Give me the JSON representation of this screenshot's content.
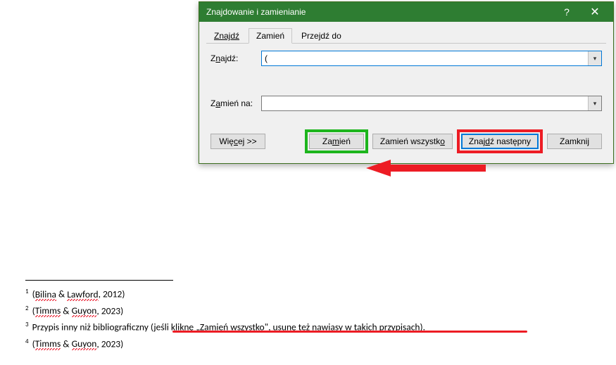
{
  "dialog": {
    "title": "Znajdowanie i zamienianie",
    "help_symbol": "?",
    "close_symbol": "✕",
    "tabs": {
      "find": "Znajdź",
      "replace": "Zamień",
      "goto": "Przejdź do"
    },
    "find_label_pre": "Z",
    "find_label_ul": "n",
    "find_label_post": "ajdź:",
    "find_value": "(",
    "replace_label_pre": "Z",
    "replace_label_ul": "a",
    "replace_label_post": "mień na:",
    "replace_value": "",
    "buttons": {
      "more_pre": "Wię",
      "more_ul": "c",
      "more_post": "ej >>",
      "replace_pre": "Za",
      "replace_ul": "m",
      "replace_post": "ień",
      "replace_all_pre": "Zamień wszystk",
      "replace_all_ul": "o",
      "replace_all_post": "",
      "find_next_pre": "Znaj",
      "find_next_ul": "d",
      "find_next_post": "ź następny",
      "close": "Zamknij"
    }
  },
  "footnotes": {
    "fn1": {
      "num": "1",
      "open": " (",
      "a": "Bilina",
      "amp": " & ",
      "b": "Lawford",
      "tail": ", 2012)"
    },
    "fn2": {
      "num": "2",
      "open": " (",
      "a": "Timms",
      "amp": " & ",
      "b": "Guyon",
      "tail": ", 2023)"
    },
    "fn3": {
      "num": "3",
      "text": " Przypis inny niż bibliograficzny (jeśli kliknę „Zamień wszystko\", usunę też nawiasy w takich przypisach)."
    },
    "fn4": {
      "num": "4",
      "open": " (",
      "a": "Timms",
      "amp": " & ",
      "b": "Guyon",
      "tail": ", 2023)"
    }
  }
}
